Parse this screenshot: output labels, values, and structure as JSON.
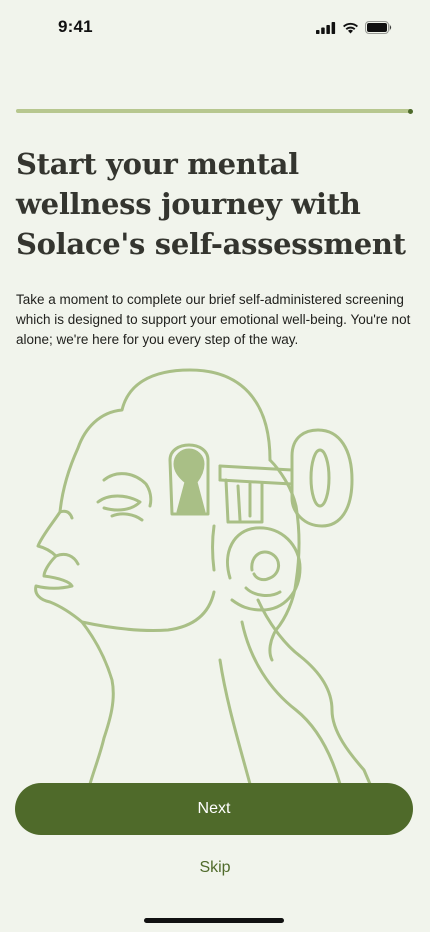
{
  "status_bar": {
    "time": "9:41",
    "icons": [
      "cellular-signal-icon",
      "wifi-icon",
      "battery-icon"
    ]
  },
  "progress": {
    "fraction": 1.0
  },
  "headline": "Start your mental wellness journey with Solace's self-assessment",
  "subtitle": "Take a moment to complete our brief self-administered screening which is designed to support your emotional well-being. You're not alone; we're here for you every step of the way.",
  "illustration": {
    "icon": "head-with-key-illustration",
    "stroke_color": "#a9bf86"
  },
  "actions": {
    "next_label": "Next",
    "skip_label": "Skip"
  },
  "colors": {
    "background": "#f1f4ec",
    "primary": "#4f6a2a",
    "illustration": "#a9bf86"
  }
}
